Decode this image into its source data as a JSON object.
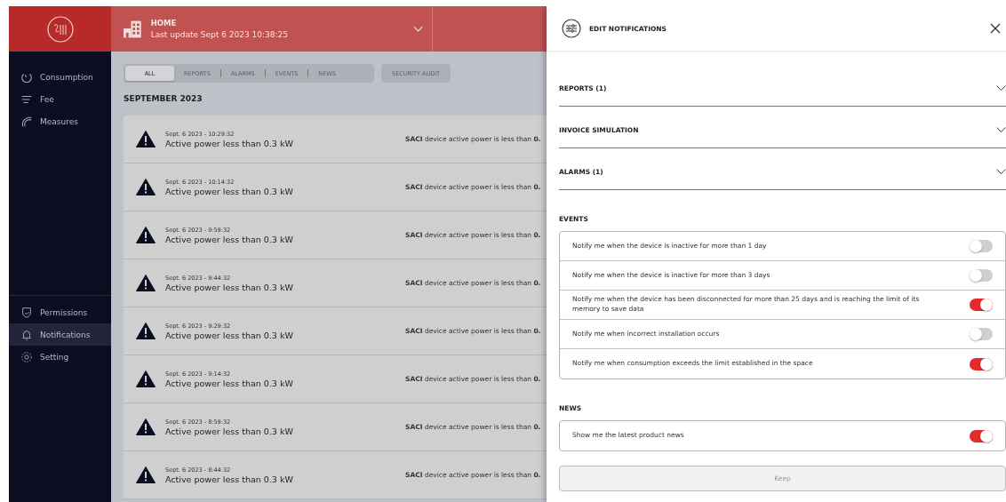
{
  "header": {
    "location": "HOME",
    "last_update": "Last update Sept 6 2023 10:38:25"
  },
  "sidebar": {
    "top_items": [
      {
        "label": "Consumption",
        "selected": false
      },
      {
        "label": "Fee",
        "selected": false
      },
      {
        "label": "Measures",
        "selected": false
      }
    ],
    "bottom_items": [
      {
        "label": "Permissions",
        "selected": false
      },
      {
        "label": "Notifications",
        "selected": true
      },
      {
        "label": "Setting",
        "selected": false
      }
    ]
  },
  "tabs": [
    {
      "label": "ALL",
      "selected": true
    },
    {
      "label": "REPORTS",
      "selected": false
    },
    {
      "label": "ALARMS",
      "selected": false
    },
    {
      "label": "EVENTS",
      "selected": false
    },
    {
      "label": "NEWS",
      "selected": false
    }
  ],
  "audit_button": "SECURITY AUDIT",
  "month": "SEPTEMBER 2023",
  "notifications": [
    {
      "time": "Sept. 6 2023 - 10:29:32",
      "title": "Active power less than 0.3 kW",
      "description": "**SACI** device active power is less than **0.**"
    },
    {
      "time": "Sept. 6 2023 - 10:14:32",
      "title": "Active power less than 0.3 kW",
      "description": "**SACI** device active power is less than **0.**"
    },
    {
      "time": "Sept. 6 2023 - 9:59:32",
      "title": "Active power less than 0.3 kW",
      "description": "**SACI** device active power is less than **0.**"
    },
    {
      "time": "Sept. 6 2023 - 9:44:32",
      "title": "Active power less than 0.3 kW",
      "description": "**SACI** device active power is less than **0.**"
    },
    {
      "time": "Sept. 6 2023 - 9:29:32",
      "title": "Active power less than 0.3 kW",
      "description": "**SACI** device active power is less than **0.**"
    },
    {
      "time": "Sept. 6 2023 - 9:14:32",
      "title": "Active power less than 0.3 kW",
      "description": "**SACI** device active power is less than **0.**"
    },
    {
      "time": "Sept. 6 2023 - 8:59:32",
      "title": "Active power less than 0.3 kW",
      "description": "**SACI** device active power is less than **0.**"
    },
    {
      "time": "Sept. 6 2023 - 8:44:32",
      "title": "Active power less than 0.3 kW",
      "description": "**SACI** device active power is less than **0.**"
    }
  ],
  "panel": {
    "title": "EDIT NOTIFICATIONS",
    "accordions": [
      {
        "label": "REPORTS (1)",
        "expanded": false
      },
      {
        "label": "INVOICE SIMULATION",
        "expanded": false
      },
      {
        "label": "ALARMS (1)",
        "expanded": false
      }
    ],
    "sections": [
      {
        "title": "EVENTS",
        "options": [
          {
            "label": "Notify me when the device is inactive for more than 1 day",
            "on": false
          },
          {
            "label": "Notify me when the device is inactive for more than 3 days",
            "on": false
          },
          {
            "label": "Notify me when the device has been disconnected for more than 25 days and is reaching the limit of its memory to save data",
            "on": true
          },
          {
            "label": "Notify me when incorrect installation occurs",
            "on": false
          },
          {
            "label": "Notify me when consumption exceeds the limit established in the space",
            "on": true
          }
        ]
      },
      {
        "title": "NEWS",
        "options": [
          {
            "label": "Show me the latest product news",
            "on": true
          }
        ]
      }
    ],
    "keep_button": "Keep"
  }
}
